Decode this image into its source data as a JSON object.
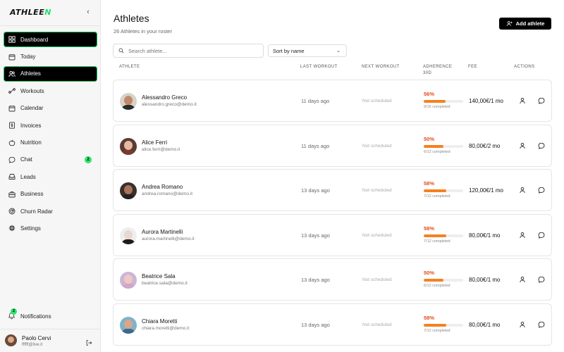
{
  "app": {
    "logo_main": "ATHLEE",
    "logo_accent": "N"
  },
  "sidebar": {
    "items": [
      {
        "label": "Dashboard",
        "icon": "dashboard-icon",
        "active": true
      },
      {
        "label": "Today",
        "icon": "calendar-today-icon",
        "active": false
      },
      {
        "label": "Athletes",
        "icon": "users-icon",
        "active": true
      },
      {
        "label": "Workouts",
        "icon": "dumbbell-icon",
        "active": false
      },
      {
        "label": "Calendar",
        "icon": "calendar-icon",
        "active": false
      },
      {
        "label": "Invoices",
        "icon": "invoice-icon",
        "active": false
      },
      {
        "label": "Nutrition",
        "icon": "apple-icon",
        "active": false
      },
      {
        "label": "Chat",
        "icon": "chat-icon",
        "active": false,
        "badge": "2"
      },
      {
        "label": "Leads",
        "icon": "inbox-icon",
        "active": false
      },
      {
        "label": "Business",
        "icon": "briefcase-icon",
        "active": false
      },
      {
        "label": "Churn Radar",
        "icon": "radar-icon",
        "active": false
      },
      {
        "label": "Settings",
        "icon": "gear-icon",
        "active": false
      }
    ],
    "notifications": {
      "label": "Notifications",
      "badge": "2"
    },
    "user": {
      "name": "Paolo Cervi",
      "email": "ffffff@live.it"
    }
  },
  "page": {
    "title": "Athletes",
    "subtitle": "26 Athletes in your roster",
    "add_button": "Add athlete",
    "search_placeholder": "Search athlete...",
    "sort_value": "Sort by name"
  },
  "table": {
    "headers": {
      "athlete": "ATHLETE",
      "last_workout": "LAST WORKOUT",
      "next_workout": "NEXT WORKOUT",
      "adherence_line1": "ADHERENCE",
      "adherence_line2": "30D",
      "fee": "FEE",
      "actions": "ACTIONS"
    },
    "rows": [
      {
        "name": "Alessandro Greco",
        "email": "alessandro.greco@demo.it",
        "last": "11 days ago",
        "next": "Not scheduled",
        "pct": "56%",
        "adherence": 0.56,
        "completed": "9/16 completed",
        "fee": "140,00€/1 mo",
        "skin": "#c08a6a",
        "shirt": "#2b2b2b",
        "bg": "#d9d2c8"
      },
      {
        "name": "Alice Ferri",
        "email": "alice.ferri@demo.it",
        "last": "11 days ago",
        "next": "Not scheduled",
        "pct": "50%",
        "adherence": 0.5,
        "completed": "6/12 completed",
        "fee": "80,00€/2 mo",
        "skin": "#e7b9a2",
        "shirt": "#7a3b2e",
        "bg": "#5a3c33"
      },
      {
        "name": "Andrea Romano",
        "email": "andrea.romano@demo.it",
        "last": "13 days ago",
        "next": "Not scheduled",
        "pct": "58%",
        "adherence": 0.58,
        "completed": "7/12 completed",
        "fee": "120,00€/1 mo",
        "skin": "#a8745a",
        "shirt": "#222",
        "bg": "#3a2f2a"
      },
      {
        "name": "Aurora Martinelli",
        "email": "aurora.martinelli@demo.it",
        "last": "13 days ago",
        "next": "Not scheduled",
        "pct": "58%",
        "adherence": 0.58,
        "completed": "7/12 completed",
        "fee": "80,00€/1 mo",
        "skin": "#e8d8cf",
        "shirt": "#1c1c1c",
        "bg": "#eeeeee"
      },
      {
        "name": "Beatrice Sala",
        "email": "beatrice.sala@demo.it",
        "last": "13 days ago",
        "next": "Not scheduled",
        "pct": "50%",
        "adherence": 0.5,
        "completed": "6/12 completed",
        "fee": "80,00€/1 mo",
        "skin": "#f0c8c0",
        "shirt": "#d3a5c8",
        "bg": "#c9b7d8"
      },
      {
        "name": "Chiara Moretti",
        "email": "chiara.moretti@demo.it",
        "last": "13 days ago",
        "next": "Not scheduled",
        "pct": "58%",
        "adherence": 0.58,
        "completed": "7/12 completed",
        "fee": "80,00€/1 mo",
        "skin": "#d9a58c",
        "shirt": "#3c6b8a",
        "bg": "#7fb3c7"
      }
    ]
  },
  "colors": {
    "accent": "#22e06b",
    "adherence_text": "#e44b1d",
    "adherence_fill": "#f5811f"
  }
}
